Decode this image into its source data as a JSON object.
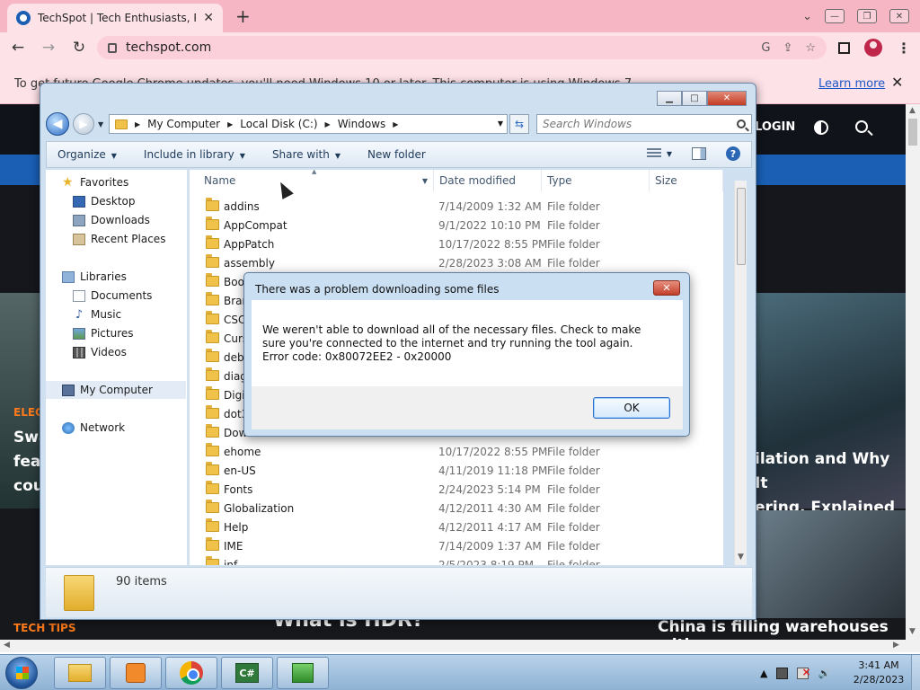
{
  "browser": {
    "tab_title": "TechSpot | Tech Enthusiasts, Pow",
    "tab_close": "✕",
    "new_tab": "+",
    "url": "techspot.com",
    "back": "←",
    "forward": "→",
    "reload": "↻",
    "menu": "⋮",
    "tab_list": "⌄",
    "min": "—",
    "restore": "❐",
    "close": "✕"
  },
  "notice": {
    "text": "To get future Google Chrome updates, you'll need Windows 10 or later. This computer is using Windows 7.",
    "learn_more": "Learn more",
    "close": "✕"
  },
  "site": {
    "login": "LOGIN",
    "electronics_label": "ELEC",
    "left_headline_lines": [
      "Swa",
      "feas",
      "cou"
    ],
    "right_headline_lines": [
      "ilation and Why It",
      "ering, Explained"
    ],
    "tech_tips": "TECH TIPS",
    "hdr_title": "What is HDR?",
    "china_title": "China is filling warehouses with"
  },
  "explorer": {
    "back": "◀",
    "forward": "▶",
    "history_drop": "▼",
    "crumbs": [
      "My Computer",
      "Local Disk (C:)",
      "Windows"
    ],
    "crumb_sep": "▶",
    "addr_drop": "▼",
    "refresh": "⇆",
    "search_placeholder": "Search Windows",
    "commands": [
      "Organize",
      "Include in library",
      "Share with",
      "New folder"
    ],
    "cmd_drop": "▼",
    "help": "?",
    "cap_min": "▁",
    "cap_max": "□",
    "cap_close": "✕",
    "nav": {
      "favorites": "Favorites",
      "desktop": "Desktop",
      "downloads": "Downloads",
      "recent": "Recent Places",
      "libraries": "Libraries",
      "documents": "Documents",
      "music": "Music",
      "pictures": "Pictures",
      "videos": "Videos",
      "computer": "My Computer",
      "network": "Network"
    },
    "columns": {
      "name": "Name",
      "date": "Date modified",
      "type": "Type",
      "size": "Size",
      "sort_up": "▲",
      "name_drop": "▼"
    },
    "files": [
      {
        "name": "addins",
        "date": "7/14/2009 1:32 AM",
        "type": "File folder"
      },
      {
        "name": "AppCompat",
        "date": "9/1/2022 10:10 PM",
        "type": "File folder"
      },
      {
        "name": "AppPatch",
        "date": "10/17/2022 8:55 PM",
        "type": "File folder"
      },
      {
        "name": "assembly",
        "date": "2/28/2023 3:08 AM",
        "type": "File folder"
      },
      {
        "name": "Boot",
        "date": "",
        "type": ""
      },
      {
        "name": "Bran",
        "date": "",
        "type": ""
      },
      {
        "name": "CSC",
        "date": "",
        "type": ""
      },
      {
        "name": "Curs",
        "date": "",
        "type": ""
      },
      {
        "name": "debu",
        "date": "",
        "type": ""
      },
      {
        "name": "diag",
        "date": "",
        "type": ""
      },
      {
        "name": "Digit",
        "date": "",
        "type": ""
      },
      {
        "name": "dot3",
        "date": "",
        "type": ""
      },
      {
        "name": "Dow",
        "date": "",
        "type": ""
      },
      {
        "name": "ehome",
        "date": "10/17/2022 8:55 PM",
        "type": "File folder"
      },
      {
        "name": "en-US",
        "date": "4/11/2019 11:18 PM",
        "type": "File folder"
      },
      {
        "name": "Fonts",
        "date": "2/24/2023 5:14 PM",
        "type": "File folder"
      },
      {
        "name": "Globalization",
        "date": "4/12/2011 4:30 AM",
        "type": "File folder"
      },
      {
        "name": "Help",
        "date": "4/12/2011 4:17 AM",
        "type": "File folder"
      },
      {
        "name": "IME",
        "date": "7/14/2009 1:37 AM",
        "type": "File folder"
      },
      {
        "name": "inf",
        "date": "2/5/2023 8:19 PM",
        "type": "File folder"
      }
    ],
    "items_count": "90 items"
  },
  "dialog": {
    "title": "There was a problem downloading some files",
    "message": "We weren't able to download all of the necessary files. Check to make sure you're connected to the internet and try running the tool again. Error code: 0x80072EE2 - 0x20000",
    "ok": "OK",
    "close": "✕"
  },
  "taskbar": {
    "cs_label": "C#",
    "tray_up": "▲",
    "volume": "🔊",
    "time": "3:41 AM",
    "date": "2/28/2023"
  },
  "colors": {
    "chrome_tab_bg": "#f7b6c4",
    "chrome_toolbar": "#fde2e8",
    "site_nav": "#1a5fb4",
    "accent_orange": "#ff7a1a"
  }
}
